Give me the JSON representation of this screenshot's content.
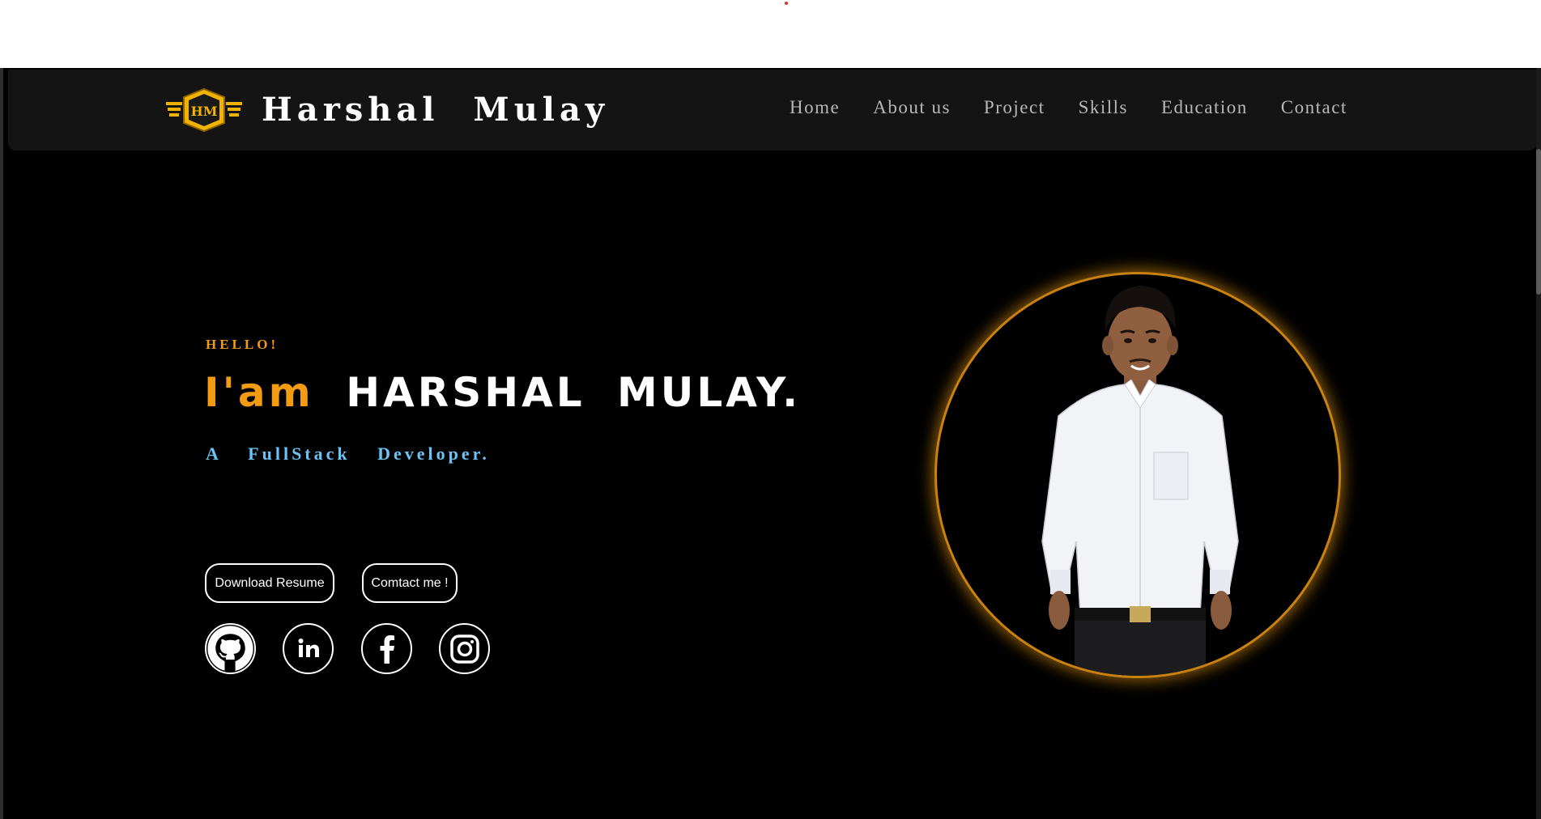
{
  "header": {
    "logo_text": "HM",
    "brand": "Harshal Mulay",
    "nav": [
      "Home",
      "About us",
      "Project",
      "Skills",
      "Education",
      "Contact"
    ]
  },
  "hero": {
    "greeting": "HELLO!",
    "intro": "I'am",
    "name": "HARSHAL MULAY.",
    "role": "A FullStack Developer.",
    "buttons": {
      "resume": "Download Resume",
      "contact": "Comtact me !"
    },
    "socials": [
      "github-icon",
      "linkedin-icon",
      "facebook-icon",
      "instagram-icon"
    ]
  },
  "colors": {
    "accent": "#f39c12",
    "role": "#6cc3f5",
    "background": "#000000",
    "navbar": "#141414"
  }
}
